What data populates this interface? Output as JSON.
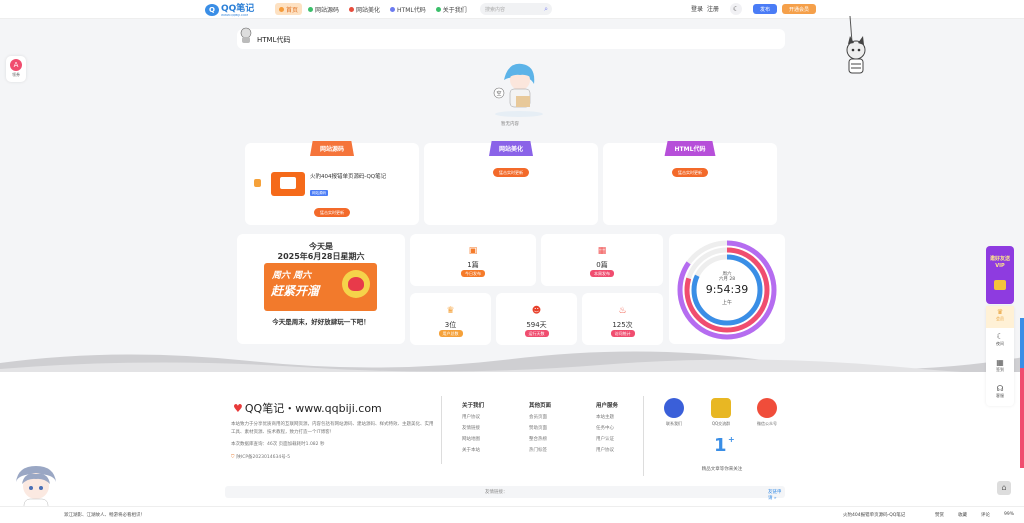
{
  "header": {
    "logo_text": "QQ笔记",
    "logo_sub": "WWW.QQBIJI.COM",
    "nav": [
      {
        "label": "首页",
        "icon": "home-icon",
        "color": "#f59b3a"
      },
      {
        "label": "网站源码",
        "icon": "map-pin-icon",
        "color": "#3bbf6a"
      },
      {
        "label": "网站美化",
        "icon": "star-icon",
        "color": "#e74c3c"
      },
      {
        "label": "HTML代码",
        "icon": "dot-icon",
        "color": "#6c7bf0"
      },
      {
        "label": "关于我们",
        "icon": "dot-icon",
        "color": "#3bbf6a"
      }
    ],
    "search_placeholder": "搜索内容",
    "login": "登录",
    "register": "注册",
    "post_btn": "发布",
    "vip_btn": "开通会员"
  },
  "left_float": {
    "label": "领券"
  },
  "breadcrumb": {
    "title": "HTML代码"
  },
  "empty": {
    "text": "暂无内容"
  },
  "categories": [
    {
      "title": "网站源码",
      "color": "#f5743a",
      "post_title": "火豹404报错单页源码-QQ笔记",
      "post_tag": "网站源码",
      "button": "猛击实时更新"
    },
    {
      "title": "网站美化",
      "color": "#8a63e8",
      "button": "猛击实时更新"
    },
    {
      "title": "HTML代码",
      "color": "#b64fd9",
      "button": "猛击实时更新"
    }
  ],
  "today": {
    "title": "今天是",
    "date": "2025年6月28日星期六",
    "banner_top": "周六 周六",
    "banner_main": "赶紧开溜",
    "message": "今天是周末，好好放肆玩一下吧！"
  },
  "stats": [
    {
      "value": "1篇",
      "label": "今日发布",
      "color": "#f57b2a",
      "icon": "document-icon"
    },
    {
      "value": "0篇",
      "label": "本周发布",
      "color": "#f04d6f",
      "icon": "calendar-icon"
    },
    {
      "value": "3位",
      "label": "用户总数",
      "color": "#f5a13a",
      "icon": "crown-icon"
    },
    {
      "value": "594天",
      "label": "运行天数",
      "color": "#f04d6f",
      "icon": "smile-icon"
    },
    {
      "value": "125次",
      "label": "访问统计",
      "color": "#f04d6f",
      "icon": "flame-icon"
    }
  ],
  "clock": {
    "weekday": "周六",
    "date": "六月 28",
    "time": "9:54:39",
    "period": "上午"
  },
  "footer": {
    "brand": "QQ笔记・www.qqbiji.com",
    "desc": "本站致力于分享优质商用的互联网资源，内容包括有网站源码、建站源码、样式特效、主题美化、实用工具、素材资源、技术教程，致力打造一个IT博客！",
    "query": "本次数据库查询：46次 页面加载耗时1.082 秒",
    "icp": "陕ICP备2023014634号-5",
    "columns": [
      {
        "title": "关于我们",
        "items": [
          "用户协议",
          "友情链接",
          "网站地图",
          "关于本站"
        ]
      },
      {
        "title": "其他页面",
        "items": [
          "会员页面",
          "赞助页面",
          "整合热榜",
          "热门标签"
        ]
      },
      {
        "title": "用户服务",
        "items": [
          "本站主题",
          "任务中心",
          "用户认证",
          "用户协议"
        ]
      }
    ],
    "social": [
      {
        "label": "联系我们",
        "color": "#3a5fd9"
      },
      {
        "label": "QQ交流群",
        "color": "#e8b723"
      },
      {
        "label": "微信公众号",
        "color": "#f04d3a"
      }
    ],
    "counter": "1",
    "counter_sup": "+",
    "counter_label": "精品文章等你来关注",
    "friend_links": "友情链接：",
    "apply_link": "友链申请 »"
  },
  "bottom_bar": {
    "left_text": "漱江湖影、江湖故人、畅游将必看相识！",
    "right_title": "火豹404报错单页源码-QQ笔记",
    "like": "赞赏",
    "favorite": "收藏",
    "comment": "评论",
    "percent": "99%"
  },
  "right_float": {
    "promo": "邀好友送VIP",
    "items": [
      "会员",
      "夜间",
      "签到",
      "客服"
    ]
  }
}
